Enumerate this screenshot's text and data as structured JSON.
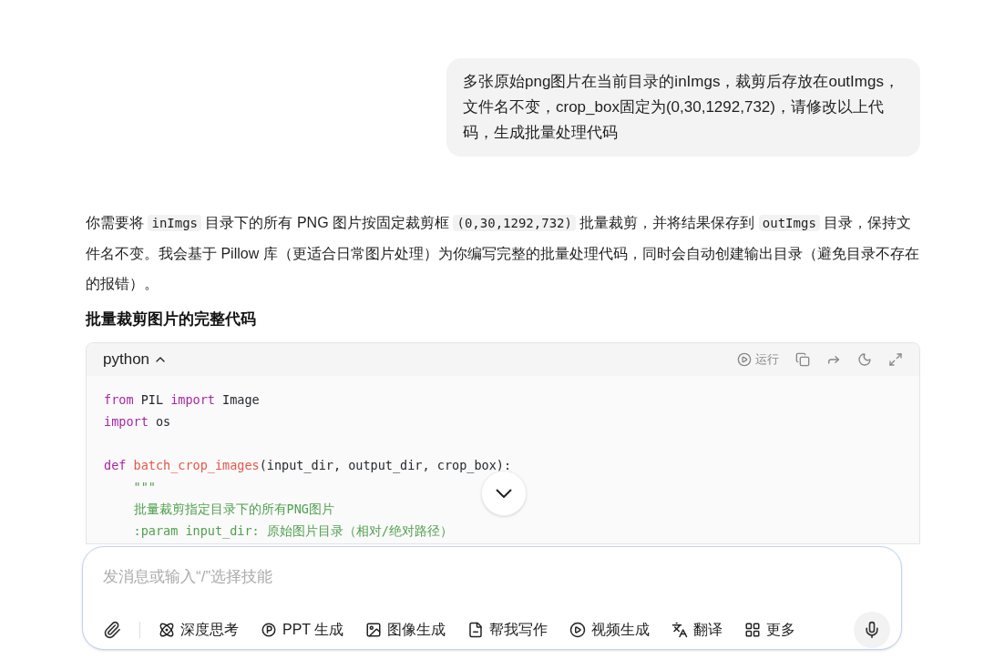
{
  "user_message": "多张原始png图片在当前目录的inImgs，裁剪后存放在outImgs，文件名不变，crop_box固定为(0,30,1292,732)，请修改以上代码，生成批量处理代码",
  "reply": {
    "paragraph": [
      {
        "text": "你需要将 ",
        "code": false
      },
      {
        "text": "inImgs",
        "code": true
      },
      {
        "text": " 目录下的所有 PNG 图片按固定裁剪框 ",
        "code": false
      },
      {
        "text": "(0,30,1292,732)",
        "code": true
      },
      {
        "text": " 批量裁剪，并将结果保存到 ",
        "code": false
      },
      {
        "text": "outImgs",
        "code": true
      },
      {
        "text": " 目录，保持文件名不变。我会基于 Pillow 库（更适合日常图片处理）为你编写完整的批量处理代码，同时会自动创建输出目录（避免目录不存在的报错）。",
        "code": false
      }
    ],
    "heading": "批量裁剪图片的完整代码",
    "code_block": {
      "language": "python",
      "expanded": true,
      "actions": [
        {
          "kind": "run",
          "label": "运行"
        },
        {
          "kind": "copy"
        },
        {
          "kind": "share"
        },
        {
          "kind": "theme"
        },
        {
          "kind": "fullscreen"
        }
      ],
      "blocks": [
        [
          [
            {
              "text": "from ",
              "kind": "keyword"
            },
            {
              "text": "PIL ",
              "kind": "plain"
            },
            {
              "text": "import ",
              "kind": "keyword"
            },
            {
              "text": "Image",
              "kind": "plain"
            }
          ],
          [
            {
              "text": "import ",
              "kind": "keyword"
            },
            {
              "text": "os",
              "kind": "plain"
            }
          ]
        ],
        [
          [
            {
              "text": "def ",
              "kind": "keyword"
            },
            {
              "text": "batch_crop_images",
              "kind": "function"
            },
            {
              "text": "(input_dir, output_dir, crop_box):",
              "kind": "plain"
            }
          ],
          [
            {
              "text": "    \"\"\"",
              "kind": "string"
            }
          ],
          [
            {
              "text": "    批量裁剪指定目录下的所有PNG图片",
              "kind": "string"
            }
          ],
          [
            {
              "text": "    :param input_dir: 原始图片目录（相对/绝对路径）",
              "kind": "string"
            }
          ]
        ]
      ]
    }
  },
  "composer": {
    "placeholder": "发消息或输入“/”选择技能",
    "tools": [
      {
        "kind": "think",
        "label": "深度思考"
      },
      {
        "kind": "ppt",
        "label": "PPT 生成"
      },
      {
        "kind": "image",
        "label": "图像生成"
      },
      {
        "kind": "write",
        "label": "帮我写作"
      },
      {
        "kind": "video",
        "label": "视频生成"
      },
      {
        "kind": "translate",
        "label": "翻译"
      },
      {
        "kind": "more",
        "label": "更多"
      }
    ]
  }
}
